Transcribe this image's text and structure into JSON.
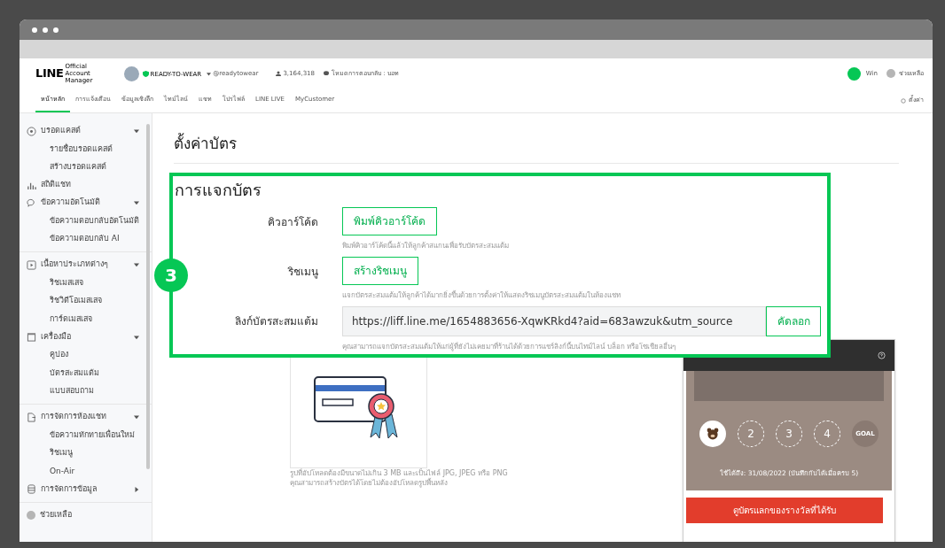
{
  "header": {
    "logo": "LINE",
    "logo_sub": "Official Account Manager",
    "account_name": "READY-TO-WEAR",
    "account_id": "@readytowear",
    "followers": "3,164,318",
    "reply_mode": "โหมดการตอบกลับ : บอท",
    "user": "Win",
    "help": "ช่วยเหลือ"
  },
  "nav": {
    "tabs": [
      {
        "label": "หน้าหลัก",
        "selected": true
      },
      {
        "label": "การแจ้งเตือน",
        "selected": false
      },
      {
        "label": "ข้อมูลเชิงลึก",
        "selected": false
      },
      {
        "label": "ไทม์ไลน์",
        "selected": false
      },
      {
        "label": "แชท",
        "selected": false
      },
      {
        "label": "โปรไฟล์",
        "selected": false
      },
      {
        "label": "LINE LIVE",
        "selected": false
      },
      {
        "label": "MyCustomer",
        "selected": false
      }
    ],
    "settings": "ตั้งค่า"
  },
  "sidebar": {
    "sections": [
      {
        "items": [
          {
            "label": "บรอดแคสต์",
            "expanded": true,
            "children": [
              {
                "label": "รายชื่อบรอดแคสต์"
              },
              {
                "label": "สร้างบรอดแคสต์"
              }
            ]
          },
          {
            "label": "สถิติแชท"
          },
          {
            "label": "ข้อความอัตโนมัติ",
            "expanded": true,
            "children": [
              {
                "label": "ข้อความตอบกลับอัตโนมัติ"
              },
              {
                "label": "ข้อความตอบกลับ AI"
              }
            ]
          }
        ]
      },
      {
        "items": [
          {
            "label": "เนื้อหาประเภทต่างๆ",
            "expanded": true,
            "children": [
              {
                "label": "ริชเมสเสจ"
              },
              {
                "label": "ริชวิดีโอเมสเสจ"
              },
              {
                "label": "การ์ดเมสเสจ"
              }
            ]
          },
          {
            "label": "เครื่องมือ",
            "expanded": true,
            "children": [
              {
                "label": "คูปอง"
              },
              {
                "label": "บัตรสะสมแต้ม"
              },
              {
                "label": "แบบสอบถาม"
              }
            ]
          }
        ]
      },
      {
        "items": [
          {
            "label": "การจัดการห้องแชท",
            "expanded": true,
            "children": [
              {
                "label": "ข้อความทักทายเพื่อนใหม่"
              },
              {
                "label": "ริชเมนู"
              },
              {
                "label": "On-Air"
              }
            ]
          },
          {
            "label": "การจัดการข้อมูล",
            "expanded": false
          }
        ]
      },
      {
        "items": [
          {
            "label": "ช่วยเหลือ"
          }
        ]
      }
    ]
  },
  "step_badge": "3",
  "main": {
    "title": "ตั้งค่าบัตร",
    "section_title": "การแจกบัตร",
    "rows": [
      {
        "kind": "button",
        "label": "คิวอาร์โค้ด",
        "button": "พิมพ์คิวอาร์โค้ด",
        "hint": "พิมพ์คิวอาร์โค้ดนี้แล้วให้ลูกค้าสแกนเพื่อรับบัตรสะสมแต้ม"
      },
      {
        "kind": "button",
        "label": "ริชเมนู",
        "button": "สร้างริชเมนู",
        "hint": "แจกบัตรสะสมแต้มให้ลูกค้าได้มากยิ่งขึ้นด้วยการตั้งค่าให้แสดงริชเมนูบัตรสะสมแต้มในห้องแชท"
      },
      {
        "kind": "link",
        "label": "ลิงก์บัตรสะสมแต้ม",
        "value": "https://liff.line.me/1654883656-XqwKRkd4?aid=683awzuk&utm_source",
        "button": "คัดลอก",
        "hint": "คุณสามารถแจกบัตรสะสมแต้มให้แก่ผู้ที่ยังไม่เคยมาที่ร้านได้ด้วยการแชร์ลิงก์นี้บนไทม์ไลน์ บล็อก หรือโซเชียลอื่นๆ"
      }
    ],
    "image_notes": [
      "รูปที่อัปโหลดต้องมีขนาดไม่เกิน 3 MB และเป็นไฟล์ JPG, JPEG หรือ PNG",
      "คุณสามารถสร้างบัตรได้โดยไม่ต้องอัปโหลดรูปพื้นหลัง"
    ]
  },
  "preview": {
    "stamps": [
      {
        "kind": "stamped"
      },
      {
        "kind": "empty",
        "label": "2"
      },
      {
        "kind": "empty",
        "label": "3"
      },
      {
        "kind": "empty",
        "label": "4"
      },
      {
        "kind": "goal",
        "label": "GOAL"
      }
    ],
    "expiry": "ใช้ได้ถึง: 31/08/2022 (บันทึกกับได้เมื่อครบ 5)",
    "button": "ดูบัตรแลกของรางวัลที่ได้รับ"
  }
}
